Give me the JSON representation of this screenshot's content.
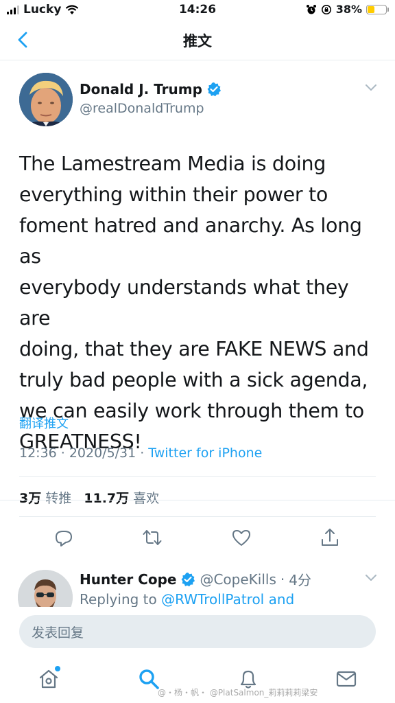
{
  "status_bar": {
    "carrier": "Lucky",
    "time": "14:26",
    "battery_percent": "38%",
    "battery_level": 0.38,
    "battery_color": "#ffcc00"
  },
  "nav": {
    "title": "推文"
  },
  "tweet": {
    "author_name": "Donald J. Trump",
    "author_handle": "@realDonaldTrump",
    "lines": [
      "The Lamestream Media is doing",
      "everything within their power to",
      "foment hatred and anarchy. As long as",
      "everybody understands what they are",
      "doing, that they are FAKE NEWS and",
      "truly bad people with a sick agenda,",
      "we can easily work through them to",
      "GREATNESS!"
    ],
    "translate_label": "翻译推文",
    "time": "12:36",
    "date": "2020/5/31",
    "source": "Twitter for iPhone",
    "retweets_count": "3万",
    "retweets_label": "转推",
    "likes_count": "11.7万",
    "likes_label": "喜欢"
  },
  "reply": {
    "author_name": "Hunter Cope",
    "author_handle": "@CopeKills",
    "time_ago": "4分",
    "replying_label": "Replying to",
    "replying_to": "@RWTrollPatrol and"
  },
  "composer": {
    "placeholder": "发表回复"
  },
  "watermark": {
    "text": "@・杨・帆・  @PlatSalmon_莉莉莉莉梁安"
  },
  "colors": {
    "accent": "#1da1f2",
    "secondary_text": "#657786",
    "divider": "#e6ecf0"
  },
  "icons": {
    "back": "chevron-left-icon",
    "verified": "verified-badge-icon",
    "reply": "reply-icon",
    "retweet": "retweet-icon",
    "like": "heart-icon",
    "share": "share-icon",
    "home": "home-icon",
    "search": "search-icon",
    "notifications": "bell-icon",
    "messages": "mail-icon"
  }
}
